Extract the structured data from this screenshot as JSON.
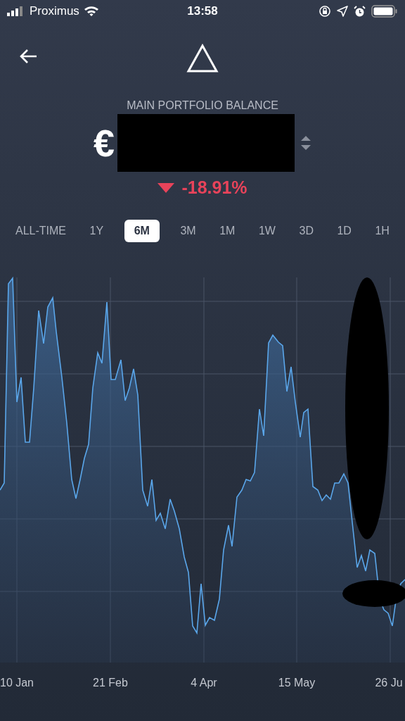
{
  "status_bar": {
    "carrier": "Proximus",
    "time": "13:58"
  },
  "balance": {
    "label": "MAIN PORTFOLIO BALANCE",
    "currency": "€",
    "change": "-18.91%",
    "falling": true
  },
  "ranges": [
    {
      "label": "ALL-TIME",
      "selected": false
    },
    {
      "label": "1Y",
      "selected": false
    },
    {
      "label": "6M",
      "selected": true
    },
    {
      "label": "3M",
      "selected": false
    },
    {
      "label": "1M",
      "selected": false
    },
    {
      "label": "1W",
      "selected": false
    },
    {
      "label": "3D",
      "selected": false
    },
    {
      "label": "1D",
      "selected": false
    },
    {
      "label": "1H",
      "selected": false
    }
  ],
  "chart": {
    "x_labels": [
      "10 Jan",
      "21 Feb",
      "4 Apr",
      "15 May",
      "26 Ju"
    ]
  }
}
